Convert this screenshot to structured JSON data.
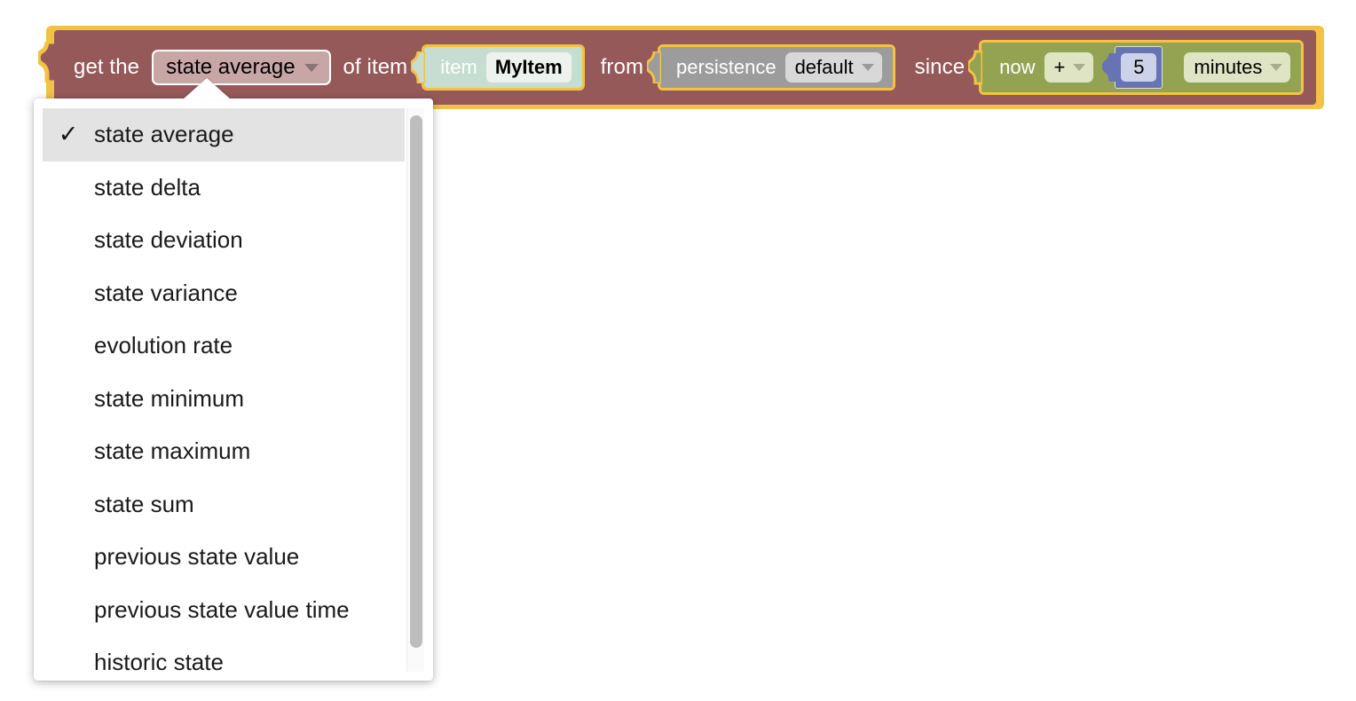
{
  "block": {
    "text_get_the": "get the",
    "aggregation_field": {
      "value": "state average",
      "icon": "chevron-down-icon"
    },
    "text_of_item": "of item",
    "item_block": {
      "label": "item",
      "value": "MyItem"
    },
    "text_from": "from",
    "persistence_block": {
      "label": "persistence",
      "value": "default",
      "icon": "chevron-down-icon"
    },
    "text_since": "since",
    "time_block": {
      "label": "now",
      "operator": "+",
      "operator_icon": "chevron-down-icon",
      "number": "5",
      "unit": "minutes",
      "unit_icon": "chevron-down-icon"
    }
  },
  "dropdown": {
    "selected": "state average",
    "check_icon": "✓",
    "items": [
      {
        "label": "state average",
        "selected": true
      },
      {
        "label": "state delta",
        "selected": false
      },
      {
        "label": "state deviation",
        "selected": false
      },
      {
        "label": "state variance",
        "selected": false
      },
      {
        "label": "evolution rate",
        "selected": false
      },
      {
        "label": "state minimum",
        "selected": false
      },
      {
        "label": "state maximum",
        "selected": false
      },
      {
        "label": "state sum",
        "selected": false
      },
      {
        "label": "previous state value",
        "selected": false
      },
      {
        "label": "previous state value time",
        "selected": false
      },
      {
        "label": "historic state",
        "selected": false
      }
    ]
  },
  "colors": {
    "block_body": "#96595a",
    "selection_outline": "#f3c244",
    "item_block": "#c5ded1",
    "persistence_block": "#9c9c9c",
    "time_block": "#94a352",
    "number_block": "#6673b5",
    "menu_highlight": "#e3e3e3",
    "page_background": "#ffffff"
  }
}
